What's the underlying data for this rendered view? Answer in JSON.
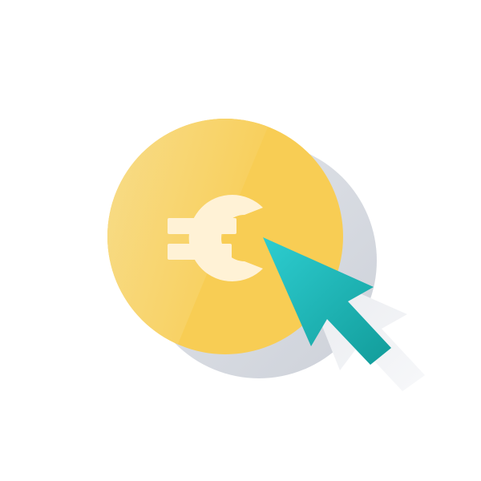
{
  "icon": {
    "name": "euro-coin-click-icon",
    "symbol": "€"
  },
  "colors": {
    "background": "#ffffff",
    "coin_light": "#f7df93",
    "coin_main": "#f8cd54",
    "symbol": "#fff2d6",
    "shadow": "#d8dbe2",
    "cursor_light": "#2dcdd0",
    "cursor_dark": "#129c9a"
  }
}
